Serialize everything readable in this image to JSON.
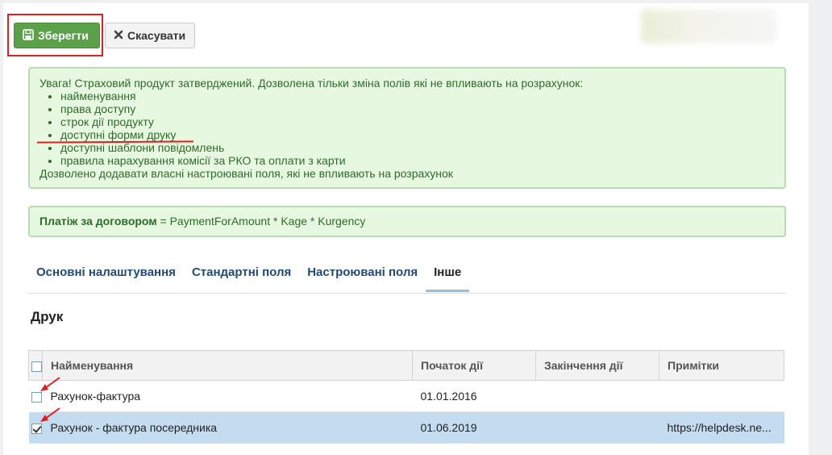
{
  "toolbar": {
    "save_label": "Зберегти",
    "cancel_label": "Скасувати"
  },
  "notice": {
    "intro": "Увага! Страховий продукт затверджений. Дозволена тільки зміна полів які не впливають на розрахунок:",
    "items": [
      "найменування",
      "права доступу",
      "строк дії продукту",
      "доступні форми друку",
      "доступні шаблони повідомлень",
      "правила нарахування комісії за РКО та оплати з карти"
    ],
    "footer": "Дозволено додавати власні настроювані поля, які не впливають на розрахунок"
  },
  "formula": {
    "label": "Платіж за договором",
    "expression": " = PaymentForAmount * Kage * Kurgency"
  },
  "tabs": [
    {
      "label": "Основні налаштування",
      "active": false
    },
    {
      "label": "Стандартні поля",
      "active": false
    },
    {
      "label": "Настроювані поля",
      "active": false
    },
    {
      "label": "Інше",
      "active": true
    }
  ],
  "section_title": "Друк",
  "table": {
    "columns": [
      "Найменування",
      "Початок дії",
      "Закінчення дії",
      "Примітки"
    ],
    "rows": [
      {
        "name": "Рахунок-фактура",
        "start": "01.01.2016",
        "end": "",
        "notes": "",
        "checked": false,
        "selected": false
      },
      {
        "name": "Рахунок - фактура посередника",
        "start": "01.06.2019",
        "end": "",
        "notes": "https://helpdesk.ne...",
        "checked": true,
        "selected": true
      }
    ]
  },
  "colors": {
    "save_button": "#5aa14a",
    "annotation_red": "#e02020",
    "notice_bg": "#e6f9e0",
    "selected_row": "#c4dcf0"
  }
}
